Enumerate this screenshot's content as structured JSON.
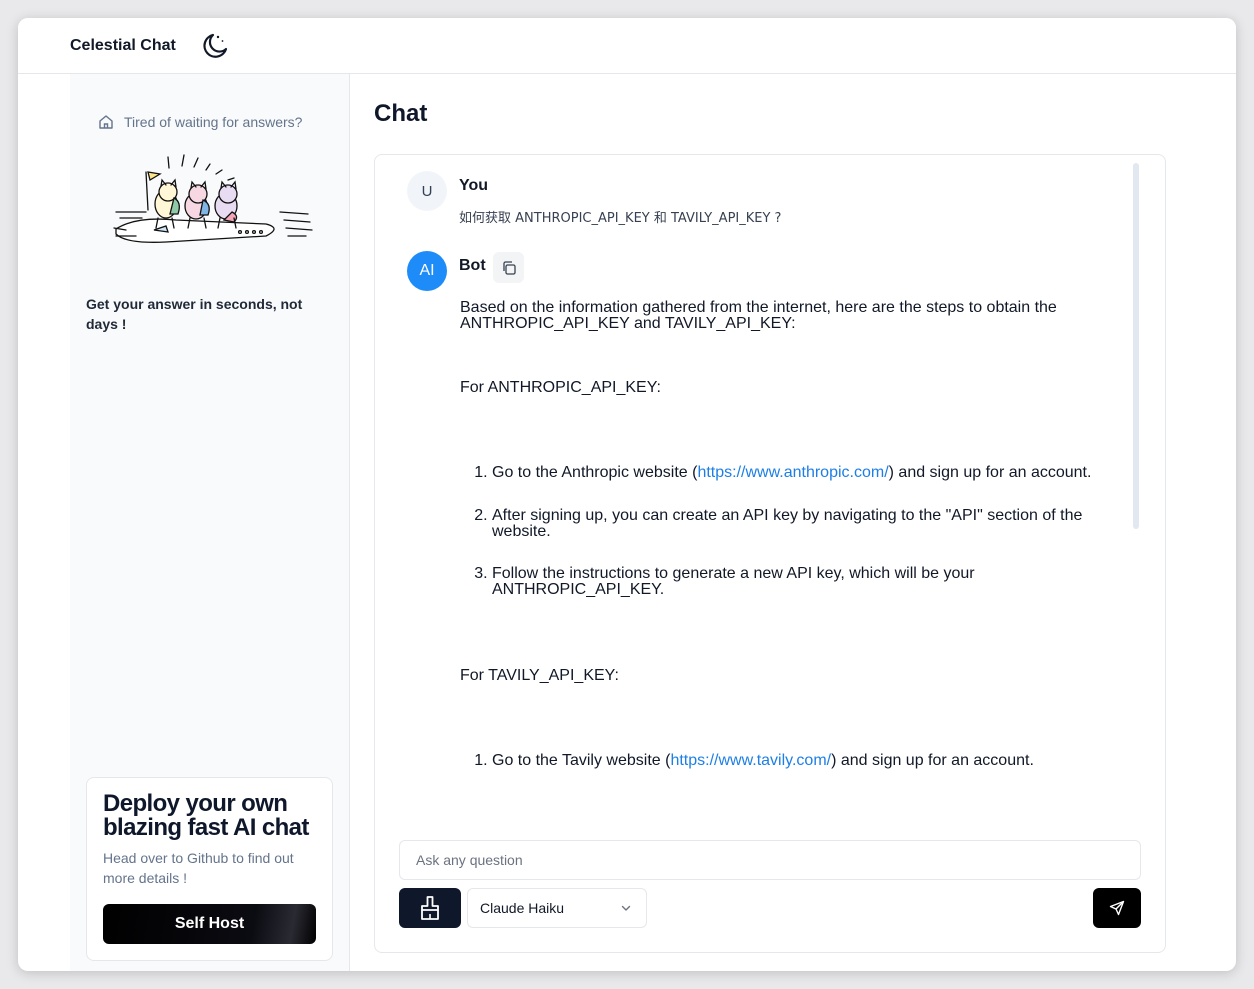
{
  "header": {
    "brand": "Celestial Chat",
    "theme_icon": "moon-icon"
  },
  "sidebar": {
    "promo_text": "Tired of waiting for answers?",
    "promo_icon": "home-icon",
    "tagline": "Get your answer in seconds, not days !",
    "deploy_card": {
      "title": "Deploy your own blazing fast AI chat",
      "description": "Head over to Github to find out more details !",
      "button_label": "Self Host"
    }
  },
  "main": {
    "title": "Chat",
    "messages": [
      {
        "avatar": "U",
        "name": "You",
        "text": "如何获取 ANTHROPIC_API_KEY 和 TAVILY_API_KEY ?"
      },
      {
        "avatar": "AI",
        "name": "Bot",
        "copy_icon": "copy-icon",
        "intro": "Based on the information gathered from the internet, here are the steps to obtain the ANTHROPIC_API_KEY and TAVILY_API_KEY:",
        "section1_heading": "For ANTHROPIC_API_KEY:",
        "section1_steps": [
          {
            "before": "Go to the Anthropic website (",
            "link": "https://www.anthropic.com/",
            "after": ") and sign up for an account."
          },
          {
            "before": "After signing up, you can create an API key by navigating to the \"API\" section of the website.",
            "link": "",
            "after": ""
          },
          {
            "before": "Follow the instructions to generate a new API key, which will be your ANTHROPIC_API_KEY.",
            "link": "",
            "after": ""
          }
        ],
        "section2_heading": "For TAVILY_API_KEY:",
        "section2_steps": [
          {
            "before": "Go to the Tavily website (",
            "link": "https://www.tavily.com/",
            "after": ") and sign up for an account."
          }
        ]
      }
    ],
    "composer": {
      "placeholder": "Ask any question",
      "value": "",
      "model": "Claude Haiku",
      "clear_icon": "brush-icon",
      "send_icon": "send-icon",
      "dropdown_icon": "chevron-down-icon"
    }
  },
  "colors": {
    "accent": "#1d8cf8",
    "link": "#1d7fe6",
    "dark_button": "#0f172a"
  }
}
